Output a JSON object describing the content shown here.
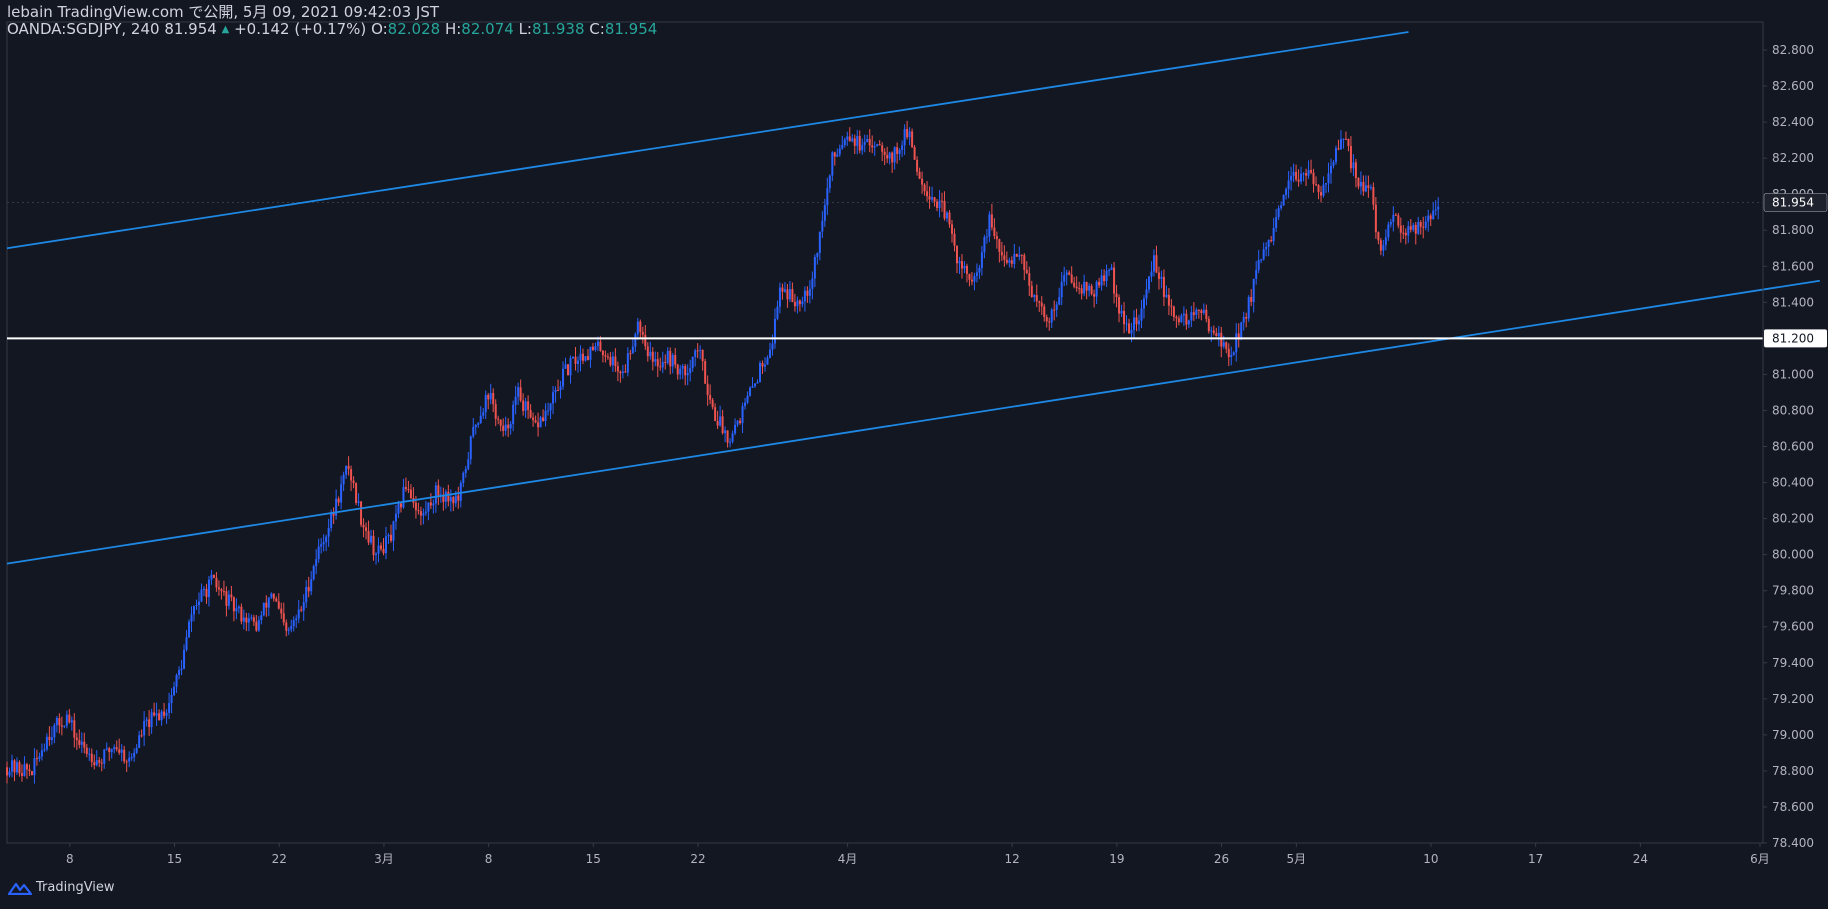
{
  "header": {
    "publisher": "lebain TradingView.com で公開, 5月 09, 2021 09:42:03 JST",
    "symbol": "OANDA:SGDJPY, 240",
    "last_price": "81.954",
    "change": "+0.142 (+0.17%)",
    "open_label": "O:",
    "open": "82.028",
    "high_label": "H:",
    "high": "82.074",
    "low_label": "L:",
    "low": "81.938",
    "close_label": "C:",
    "close": "81.954"
  },
  "footer": {
    "brand": "TradingView"
  },
  "colors": {
    "background": "#131722",
    "up": "#2962ff",
    "down": "#ef5350",
    "channel": "#1e88e5",
    "horizontal": "#ffffff",
    "axis_text": "#b2b5be",
    "axis_line": "#363a45"
  },
  "chart_data": {
    "type": "candlestick",
    "interval": "240",
    "ylim": [
      78.4,
      82.9
    ],
    "y_ticks": [
      "82.800",
      "82.600",
      "82.400",
      "82.200",
      "82.000",
      "81.800",
      "81.600",
      "81.400",
      "81.200",
      "81.000",
      "80.800",
      "80.600",
      "80.400",
      "80.200",
      "80.000",
      "79.800",
      "79.600",
      "79.400",
      "79.200",
      "79.000",
      "78.800",
      "78.600",
      "78.400"
    ],
    "x_ticks": [
      {
        "label": "8",
        "day": 8
      },
      {
        "label": "15",
        "day": 15
      },
      {
        "label": "22",
        "day": 22
      },
      {
        "label": "3月",
        "day": 29
      },
      {
        "label": "8",
        "day": 36
      },
      {
        "label": "15",
        "day": 43
      },
      {
        "label": "22",
        "day": 50
      },
      {
        "label": "4月",
        "day": 60
      },
      {
        "label": "12",
        "day": 71
      },
      {
        "label": "19",
        "day": 78
      },
      {
        "label": "26",
        "day": 85
      },
      {
        "label": "5月",
        "day": 90
      },
      {
        "label": "10",
        "day": 99
      },
      {
        "label": "17",
        "day": 106
      },
      {
        "label": "24",
        "day": 113
      },
      {
        "label": "6月",
        "day": 121
      }
    ],
    "current_price": {
      "label": "81.954",
      "value": 81.954
    },
    "horizontal_level": {
      "label": "81.200",
      "value": 81.2
    },
    "channel_upper": {
      "from": {
        "day": 3.8,
        "price": 81.7
      },
      "to": {
        "day": 97.5,
        "price": 82.9
      }
    },
    "channel_lower": {
      "from": {
        "day": 3.8,
        "price": 79.95
      },
      "to": {
        "day": 125.0,
        "price": 81.52
      }
    },
    "price_path": [
      {
        "day": 3.8,
        "price": 78.82
      },
      {
        "day": 5.5,
        "price": 78.8
      },
      {
        "day": 6.5,
        "price": 79.0
      },
      {
        "day": 7.8,
        "price": 79.1
      },
      {
        "day": 8.6,
        "price": 78.95
      },
      {
        "day": 10.0,
        "price": 78.85
      },
      {
        "day": 11.0,
        "price": 78.95
      },
      {
        "day": 12.0,
        "price": 78.85
      },
      {
        "day": 13.0,
        "price": 79.05
      },
      {
        "day": 14.5,
        "price": 79.15
      },
      {
        "day": 15.5,
        "price": 79.4
      },
      {
        "day": 16.2,
        "price": 79.7
      },
      {
        "day": 17.5,
        "price": 79.85
      },
      {
        "day": 19.0,
        "price": 79.7
      },
      {
        "day": 20.5,
        "price": 79.6
      },
      {
        "day": 21.5,
        "price": 79.8
      },
      {
        "day": 22.5,
        "price": 79.55
      },
      {
        "day": 23.5,
        "price": 79.7
      },
      {
        "day": 24.5,
        "price": 80.0
      },
      {
        "day": 25.5,
        "price": 80.2
      },
      {
        "day": 26.6,
        "price": 80.5
      },
      {
        "day": 27.5,
        "price": 80.2
      },
      {
        "day": 28.5,
        "price": 80.0
      },
      {
        "day": 29.5,
        "price": 80.1
      },
      {
        "day": 30.5,
        "price": 80.4
      },
      {
        "day": 31.5,
        "price": 80.2
      },
      {
        "day": 32.5,
        "price": 80.35
      },
      {
        "day": 34.0,
        "price": 80.3
      },
      {
        "day": 35.0,
        "price": 80.7
      },
      {
        "day": 36.0,
        "price": 80.9
      },
      {
        "day": 37.0,
        "price": 80.65
      },
      {
        "day": 38.0,
        "price": 80.9
      },
      {
        "day": 39.0,
        "price": 80.7
      },
      {
        "day": 40.0,
        "price": 80.8
      },
      {
        "day": 41.0,
        "price": 81.0
      },
      {
        "day": 42.0,
        "price": 81.1
      },
      {
        "day": 43.5,
        "price": 81.15
      },
      {
        "day": 45.0,
        "price": 81.0
      },
      {
        "day": 46.0,
        "price": 81.3
      },
      {
        "day": 47.0,
        "price": 81.05
      },
      {
        "day": 48.0,
        "price": 81.1
      },
      {
        "day": 49.0,
        "price": 81.0
      },
      {
        "day": 50.0,
        "price": 81.15
      },
      {
        "day": 51.0,
        "price": 80.8
      },
      {
        "day": 52.0,
        "price": 80.65
      },
      {
        "day": 53.0,
        "price": 80.8
      },
      {
        "day": 54.0,
        "price": 81.0
      },
      {
        "day": 55.0,
        "price": 81.2
      },
      {
        "day": 55.5,
        "price": 81.5
      },
      {
        "day": 56.5,
        "price": 81.4
      },
      {
        "day": 57.5,
        "price": 81.5
      },
      {
        "day": 58.2,
        "price": 81.8
      },
      {
        "day": 59.0,
        "price": 82.2
      },
      {
        "day": 60.0,
        "price": 82.35
      },
      {
        "day": 61.0,
        "price": 82.25
      },
      {
        "day": 62.0,
        "price": 82.3
      },
      {
        "day": 63.0,
        "price": 82.2
      },
      {
        "day": 64.0,
        "price": 82.35
      },
      {
        "day": 64.8,
        "price": 82.1
      },
      {
        "day": 65.5,
        "price": 82.0
      },
      {
        "day": 66.5,
        "price": 81.9
      },
      {
        "day": 67.5,
        "price": 81.6
      },
      {
        "day": 68.5,
        "price": 81.5
      },
      {
        "day": 69.5,
        "price": 81.85
      },
      {
        "day": 70.5,
        "price": 81.6
      },
      {
        "day": 71.5,
        "price": 81.7
      },
      {
        "day": 72.5,
        "price": 81.4
      },
      {
        "day": 73.5,
        "price": 81.3
      },
      {
        "day": 74.5,
        "price": 81.55
      },
      {
        "day": 75.5,
        "price": 81.5
      },
      {
        "day": 76.5,
        "price": 81.45
      },
      {
        "day": 77.5,
        "price": 81.6
      },
      {
        "day": 78.5,
        "price": 81.25
      },
      {
        "day": 79.5,
        "price": 81.3
      },
      {
        "day": 80.5,
        "price": 81.65
      },
      {
        "day": 81.5,
        "price": 81.35
      },
      {
        "day": 82.5,
        "price": 81.3
      },
      {
        "day": 83.5,
        "price": 81.35
      },
      {
        "day": 84.5,
        "price": 81.25
      },
      {
        "day": 85.5,
        "price": 81.1
      },
      {
        "day": 86.5,
        "price": 81.3
      },
      {
        "day": 87.5,
        "price": 81.6
      },
      {
        "day": 88.5,
        "price": 81.8
      },
      {
        "day": 89.5,
        "price": 82.05
      },
      {
        "day": 90.5,
        "price": 82.15
      },
      {
        "day": 91.5,
        "price": 82.0
      },
      {
        "day": 92.5,
        "price": 82.2
      },
      {
        "day": 93.2,
        "price": 82.3
      },
      {
        "day": 94.0,
        "price": 82.1
      },
      {
        "day": 95.0,
        "price": 82.0
      },
      {
        "day": 95.5,
        "price": 81.7
      },
      {
        "day": 96.5,
        "price": 81.85
      },
      {
        "day": 97.5,
        "price": 81.8
      },
      {
        "day": 98.5,
        "price": 81.85
      },
      {
        "day": 99.5,
        "price": 81.95
      }
    ],
    "candle_spacing_days": 0.1667
  }
}
